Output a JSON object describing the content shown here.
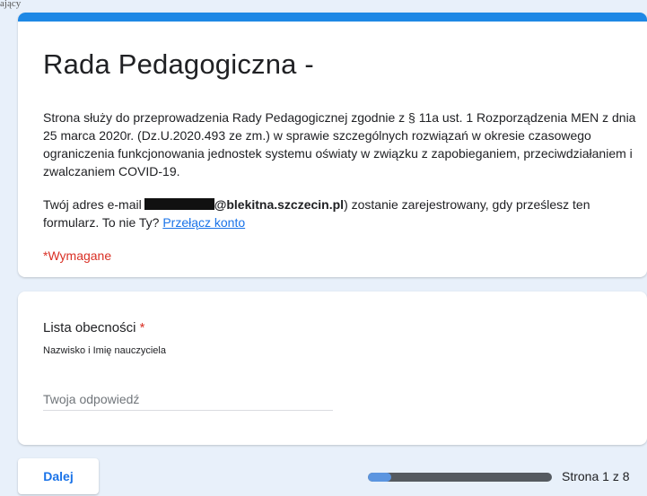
{
  "top_label": "ający",
  "header": {
    "title": "Rada Pedagogiczna -",
    "description": "Strona służy do przeprowadzenia Rady Pedagogicznej zgodnie z § 11a ust. 1 Rozporządzenia MEN z dnia 25 marca 2020r. (Dz.U.2020.493 ze zm.) w sprawie szczególnych rozwiązań w okresie czasowego ograniczenia funkcjonowania jednostek systemu oświaty w związku z zapobieganiem, przeciwdziałaniem i zwalczaniem COVID-19.",
    "email_prefix": "Twój adres e-mail",
    "email_domain": "@blekitna.szczecin.pl",
    "email_suffix": ") zostanie zarejestrowany, gdy prześlesz ten formularz. To nie Ty?",
    "switch_account_link": "Przełącz konto",
    "required_note": "*Wymagane"
  },
  "question": {
    "title": "Lista obecności",
    "required_mark": "*",
    "help_text": "Nazwisko i Imię nauczyciela",
    "answer_placeholder": "Twoja odpowiedź",
    "answer_value": ""
  },
  "footer": {
    "next_label": "Dalej",
    "progress_fraction": 0.125,
    "page_indicator": "Strona 1 z 8"
  },
  "colors": {
    "accent": "#1e88e5",
    "required": "#d93025",
    "link": "#1a73e8",
    "background": "#e8f0fa"
  }
}
